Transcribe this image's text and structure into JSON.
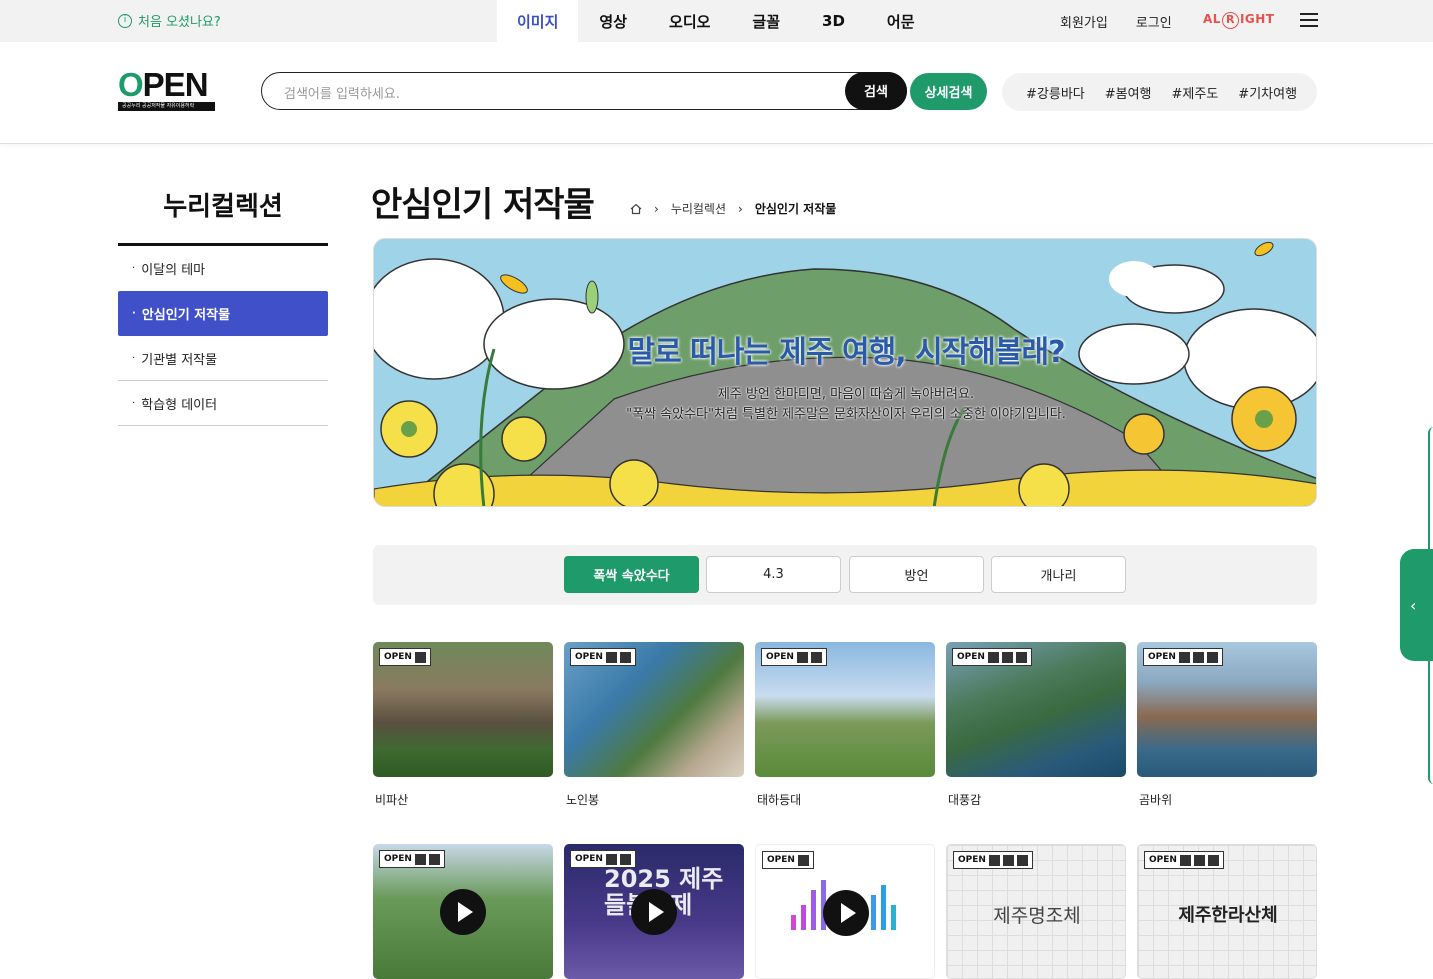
{
  "topbar": {
    "first_visit": "처음 오셨나요?",
    "nav": [
      "이미지",
      "영상",
      "오디오",
      "글꼴",
      "3D",
      "어문"
    ],
    "active_nav": "이미지",
    "join": "회원가입",
    "login": "로그인",
    "alright_logo": "ALRIGHT"
  },
  "header": {
    "logo_text": "OPEN",
    "logo_sub": "공공누리 공공저작물 자유이용허락",
    "search_placeholder": "검색어를 입력하세요.",
    "search_button": "검색",
    "advanced_button": "상세검색",
    "tags": [
      "#강릉바다",
      "#봄여행",
      "#제주도",
      "#기차여행"
    ]
  },
  "sidebar": {
    "title": "누리컬렉션",
    "items": [
      {
        "label": "이달의 테마",
        "active": false
      },
      {
        "label": "안심인기 저작물",
        "active": true
      },
      {
        "label": "기관별 저작물",
        "active": false
      },
      {
        "label": "학습형 데이터",
        "active": false
      }
    ]
  },
  "main": {
    "title": "안심인기 저작물",
    "breadcrumb": [
      "누리컬렉션",
      "안심인기 저작물"
    ],
    "banner": {
      "headline": "말로 떠나는 제주 여행, 시작해볼래?",
      "line1": "제주 방언 한마디면, 마음이 따숩게 녹아버려요.",
      "line2": "\"폭싹 속았수다\"처럼 특별한 제주말은 문화자산이자 우리의 소중한 이야기입니다."
    },
    "filters": [
      "폭싹 속았수다",
      "4.3",
      "방언",
      "개나리"
    ],
    "active_filter": "폭싹 속았수다",
    "cards_row1": [
      {
        "caption": "비파산"
      },
      {
        "caption": "노인봉"
      },
      {
        "caption": "태하등대"
      },
      {
        "caption": "대풍감"
      },
      {
        "caption": "곰바위"
      }
    ],
    "cards_row2": [
      {
        "type": "video"
      },
      {
        "type": "video",
        "poster_text": "2025 제주 들불축제"
      },
      {
        "type": "audio"
      },
      {
        "type": "font",
        "poster_text": "제주명조체"
      },
      {
        "type": "font",
        "poster_text": "제주한라산체"
      }
    ],
    "badge_text": "OPEN"
  },
  "colors": {
    "accent_green": "#1f9a6a",
    "accent_blue": "#4050c8",
    "nav_active": "#3b4dc8"
  }
}
